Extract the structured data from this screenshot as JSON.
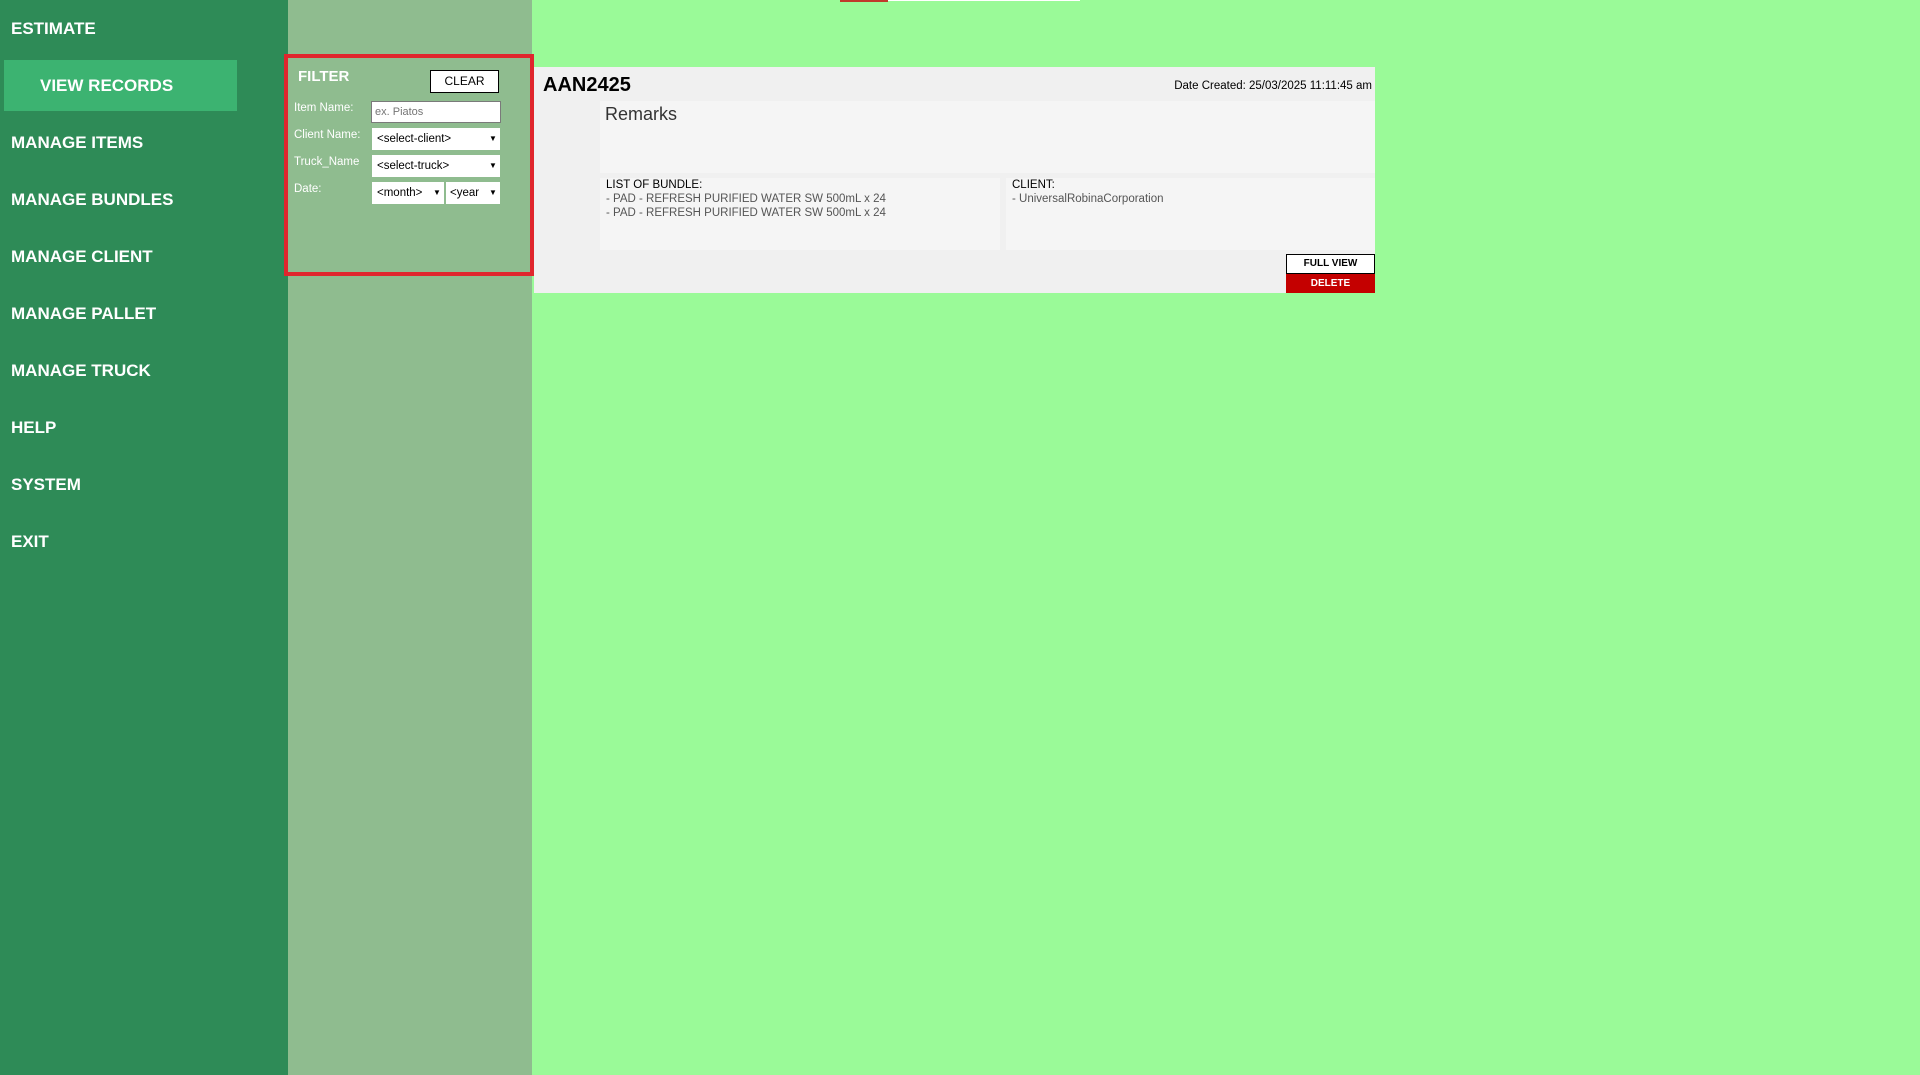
{
  "sidebar": {
    "items": [
      {
        "label": "ESTIMATE"
      },
      {
        "label": "VIEW RECORDS"
      },
      {
        "label": "MANAGE ITEMS"
      },
      {
        "label": "MANAGE BUNDLES"
      },
      {
        "label": "MANAGE CLIENT"
      },
      {
        "label": "MANAGE PALLET"
      },
      {
        "label": "MANAGE TRUCK"
      },
      {
        "label": "HELP"
      },
      {
        "label": "SYSTEM"
      },
      {
        "label": "EXIT"
      }
    ]
  },
  "filter": {
    "title": "FILTER",
    "clear_label": "CLEAR",
    "item_name_label": "Item Name:",
    "item_name_placeholder": "ex. Piatos",
    "client_label": "Client Name:",
    "client_value": "<select-client>",
    "truck_label": "Truck_Name",
    "truck_value": "<select-truck>",
    "date_label": "Date:",
    "month_value": "<month>",
    "year_value": "<year"
  },
  "record": {
    "id": "AAN2425",
    "date_created": "Date Created: 25/03/2025 11:11:45 am",
    "remarks_title": "Remarks",
    "bundles_title": "LIST OF BUNDLE:",
    "bundles": [
      "- PAD - REFRESH PURIFIED WATER SW 500mL x 24",
      "- PAD - REFRESH PURIFIED WATER SW 500mL x 24"
    ],
    "client_title": "CLIENT:",
    "clients": [
      "- UniversalRobinaCorporation"
    ],
    "full_view_label": "FULL VIEW",
    "delete_label": "DELETE"
  },
  "colors": {
    "background": "#9afa98",
    "sidebar": "#2e8b57",
    "sidebar_active": "#3cb371",
    "filter_panel": "#8fbc8f",
    "highlight_border": "#e0262d",
    "delete": "#c40000"
  },
  "icons": {
    "dropdown": "chevron-down-icon"
  }
}
